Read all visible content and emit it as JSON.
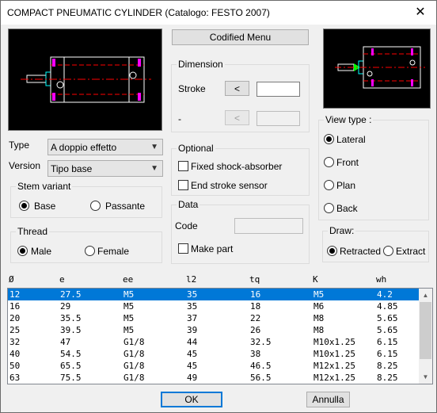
{
  "window": {
    "title": "COMPACT PNEUMATIC CYLINDER (Catalogo: FESTO 2007)",
    "close_glyph": "✕"
  },
  "buttons": {
    "codified_menu": "Codified Menu",
    "stroke_prev": "<",
    "dash_prev": "<",
    "ok": "OK",
    "cancel": "Annulla"
  },
  "dimension": {
    "legend": "Dimension",
    "stroke_label": "Stroke",
    "dash_label": "-",
    "stroke_value": "",
    "dash_value": ""
  },
  "type": {
    "label": "Type",
    "value": "A doppio effetto"
  },
  "version": {
    "label": "Version",
    "value": "Tipo base"
  },
  "stem_variant": {
    "legend": "Stem variant",
    "options": [
      "Base",
      "Passante"
    ],
    "selected": "Base"
  },
  "thread": {
    "legend": "Thread",
    "options": [
      "Male",
      "Female"
    ],
    "selected": "Male"
  },
  "optional": {
    "legend": "Optional",
    "fixed_shock": "Fixed shock-absorber",
    "end_stroke": "End stroke sensor"
  },
  "data_group": {
    "legend": "Data",
    "code_label": "Code",
    "code_value": "",
    "make_part": "Make part"
  },
  "view_type": {
    "legend": "View type  :",
    "options": [
      "Lateral",
      "Front",
      "Plan",
      "Back"
    ],
    "selected": "Lateral"
  },
  "draw": {
    "legend": "Draw:",
    "options": [
      "Retracted",
      "Extract"
    ],
    "selected": "Retracted"
  },
  "icons": {
    "close": "close-icon",
    "dropdown": "chevron-down-icon",
    "scroll_up": "scroll-up-icon",
    "scroll_down": "scroll-down-icon"
  },
  "colors": {
    "selection": "#0078d7",
    "preview_bg": "#000000",
    "drawing_red": "#ff0000",
    "drawing_white": "#ffffff",
    "drawing_magenta": "#ff00ff",
    "drawing_cyan": "#00ffff",
    "drawing_green": "#00ff00"
  },
  "table": {
    "columns": [
      "Ø",
      "e",
      "ee",
      "l2",
      "tq",
      "K",
      "wh"
    ],
    "selected_index": 0,
    "rows": [
      [
        "12",
        "27.5",
        "M5",
        "35",
        "16",
        "M5",
        "4.2"
      ],
      [
        "16",
        "29",
        "M5",
        "35",
        "18",
        "M6",
        "4.85"
      ],
      [
        "20",
        "35.5",
        "M5",
        "37",
        "22",
        "M8",
        "5.65"
      ],
      [
        "25",
        "39.5",
        "M5",
        "39",
        "26",
        "M8",
        "5.65"
      ],
      [
        "32",
        "47",
        "G1/8",
        "44",
        "32.5",
        "M10x1.25",
        "6.15"
      ],
      [
        "40",
        "54.5",
        "G1/8",
        "45",
        "38",
        "M10x1.25",
        "6.15"
      ],
      [
        "50",
        "65.5",
        "G1/8",
        "45",
        "46.5",
        "M12x1.25",
        "8.25"
      ],
      [
        "63",
        "75.5",
        "G1/8",
        "49",
        "56.5",
        "M12x1.25",
        "8.25"
      ]
    ]
  }
}
